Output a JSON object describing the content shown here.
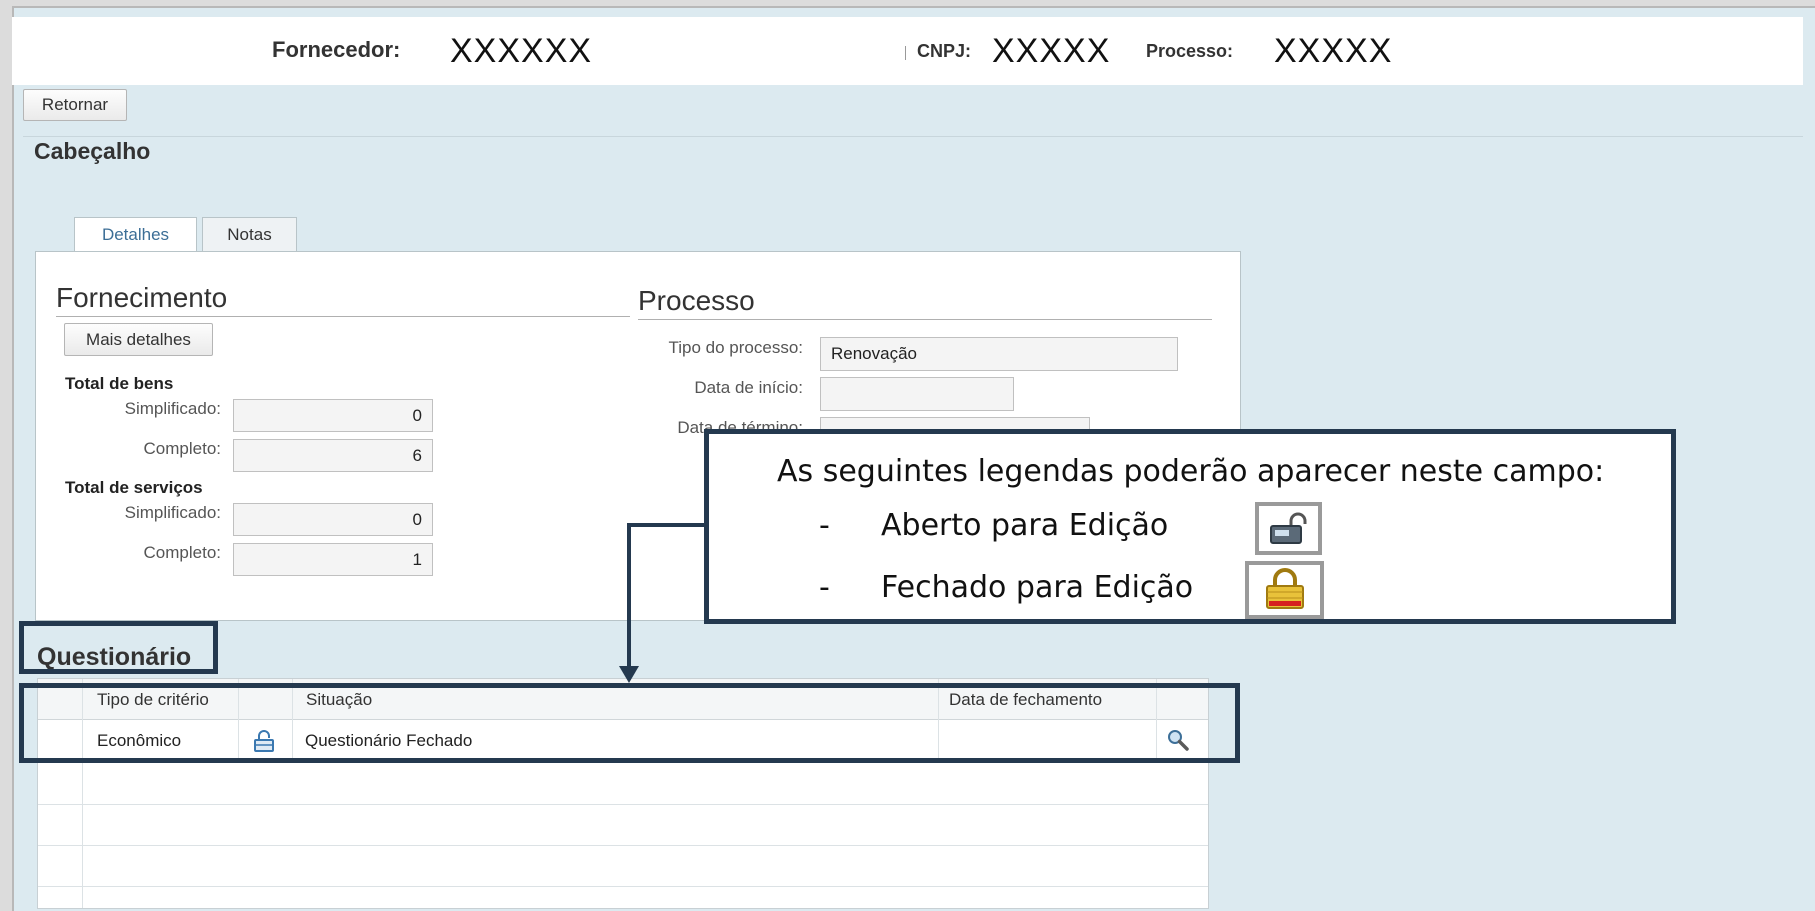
{
  "header": {
    "supplier_label": "Fornecedor:",
    "supplier_value": "XXXXXX",
    "cnpj_label": "CNPJ:",
    "cnpj_value": "XXXXX",
    "process_label": "Processo:",
    "process_value": "XXXXX"
  },
  "toolbar": {
    "back_label": "Retornar"
  },
  "header_section": {
    "title": "Cabeçalho"
  },
  "tabs": [
    {
      "label": "Detalhes",
      "active": true
    },
    {
      "label": "Notas",
      "active": false
    }
  ],
  "fornecimento": {
    "title": "Fornecimento",
    "more_details_label": "Mais detalhes",
    "goods": {
      "title": "Total de bens",
      "simplified_label": "Simplificado:",
      "simplified_value": "0",
      "complete_label": "Completo:",
      "complete_value": "6"
    },
    "services": {
      "title": "Total de serviços",
      "simplified_label": "Simplificado:",
      "simplified_value": "0",
      "complete_label": "Completo:",
      "complete_value": "1"
    }
  },
  "processo": {
    "title": "Processo",
    "type_label": "Tipo do processo:",
    "type_value": "Renovação",
    "start_label": "Data de início:",
    "start_value": "",
    "end_label": "Data de término:"
  },
  "questionario": {
    "title": "Questionário",
    "columns": [
      "Tipo de critério",
      "",
      "Situação",
      "Data de fechamento"
    ],
    "rows": [
      {
        "criterion": "Econômico",
        "status_icon": "lock-open-icon",
        "status": "Questionário Fechado",
        "closing_date": "",
        "action_icon": "magnifier-icon"
      }
    ]
  },
  "callout": {
    "headline": "As seguintes legendas poderão aparecer neste campo:",
    "items": [
      {
        "dash": "-",
        "label": "Aberto para Edição",
        "icon": "open-for-edit-icon"
      },
      {
        "dash": "-",
        "label": "Fechado para Edição",
        "icon": "closed-for-edit-icon"
      }
    ]
  },
  "colors": {
    "page_bg": "#dceaf0",
    "callout_border": "#24394f",
    "lock_icon": "#3a78b0",
    "closed_lock_bg": "#e8c23a",
    "closed_lock_bar": "#d62020"
  }
}
